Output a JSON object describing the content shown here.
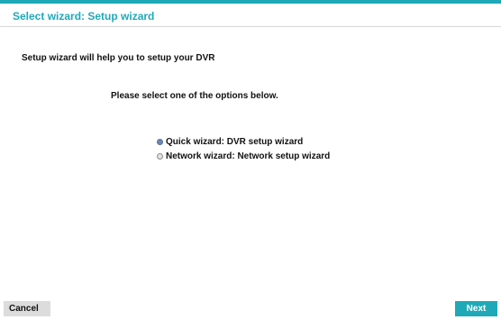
{
  "window": {
    "title": "Select wizard: Setup wizard"
  },
  "content": {
    "intro": "Setup wizard will help you to setup your DVR",
    "instruction": "Please select one of the options below.",
    "options": [
      {
        "label": "Quick wizard: DVR setup wizard",
        "selected": true
      },
      {
        "label": "Network wizard: Network setup wizard",
        "selected": false
      }
    ]
  },
  "footer": {
    "cancel_label": "Cancel",
    "next_label": "Next"
  },
  "colors": {
    "accent": "#1fa9b8",
    "cancel_bg": "#dcdcdc",
    "radio_selected": "#6d88b3"
  }
}
